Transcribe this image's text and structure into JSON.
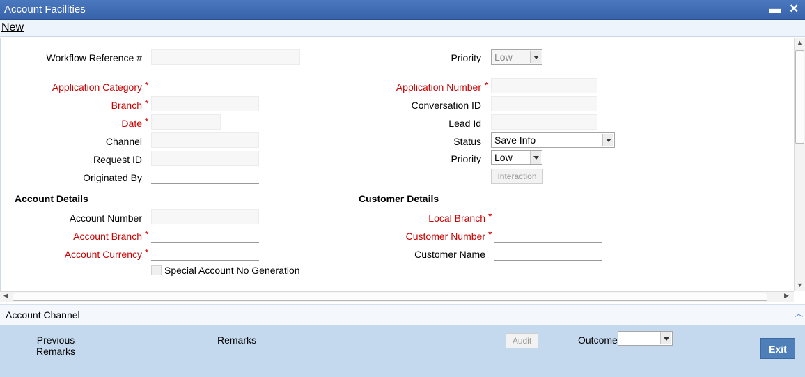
{
  "window": {
    "title": "Account Facilities",
    "minimize": "▬",
    "close": "✕"
  },
  "menu": {
    "new": "New"
  },
  "form": {
    "workflow_ref_label": "Workflow Reference #",
    "priority_top_label": "Priority",
    "priority_top_value": "Low",
    "app_category_label": "Application Category",
    "app_number_label": "Application Number",
    "branch_label": "Branch",
    "conversation_id_label": "Conversation ID",
    "date_label": "Date",
    "lead_id_label": "Lead Id",
    "channel_label": "Channel",
    "status_label": "Status",
    "status_value": "Save Info",
    "request_id_label": "Request ID",
    "priority_label": "Priority",
    "priority_value": "Low",
    "originated_by_label": "Originated By",
    "interaction_button": "Interaction",
    "required_mark": "*"
  },
  "account_details": {
    "title": "Account Details",
    "account_number_label": "Account Number",
    "account_branch_label": "Account Branch",
    "account_currency_label": "Account Currency",
    "special_account_label": "Special Account No Generation"
  },
  "customer_details": {
    "title": "Customer Details",
    "local_branch_label": "Local Branch",
    "customer_number_label": "Customer Number",
    "customer_name_label": "Customer Name"
  },
  "channel_bar": {
    "title": "Account Channel"
  },
  "footer": {
    "previous_remarks_line1": "Previous",
    "previous_remarks_line2": "Remarks",
    "remarks_label": "Remarks",
    "audit_button": "Audit",
    "outcome_label": "Outcome",
    "exit_button": "Exit"
  },
  "colors": {
    "titlebar": "#3f6db5",
    "required": "#cc0000",
    "footer": "#c4d9ee",
    "exit": "#4f7fb8"
  }
}
